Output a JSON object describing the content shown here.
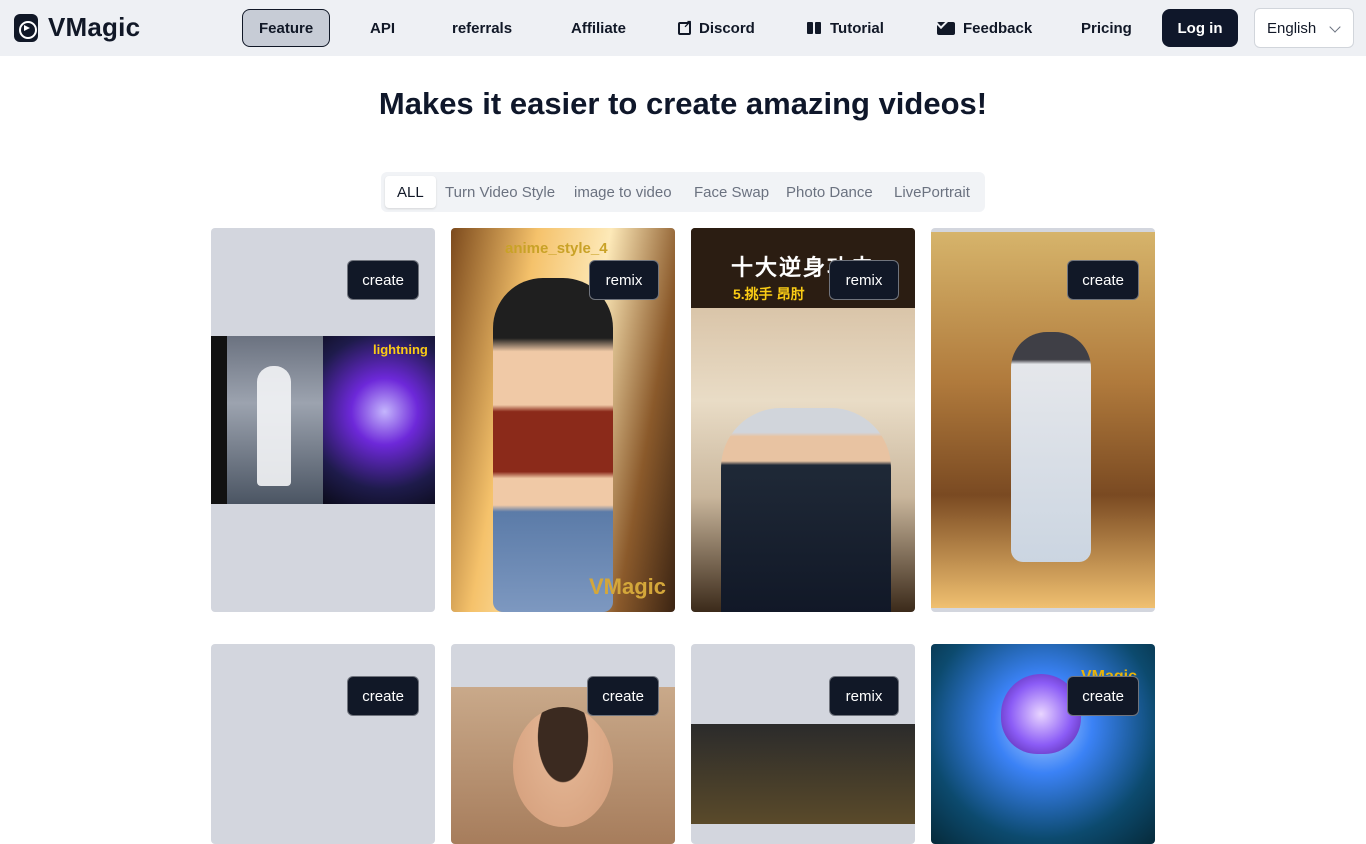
{
  "header": {
    "logo_text": "VMagic",
    "nav": [
      {
        "label": "Feature",
        "active": true
      },
      {
        "label": "API"
      },
      {
        "label": "referrals"
      },
      {
        "label": "Affiliate"
      },
      {
        "label": "Discord",
        "icon": "external-link-icon"
      },
      {
        "label": "Tutorial",
        "icon": "book-icon"
      },
      {
        "label": "Feedback",
        "icon": "mail-icon"
      },
      {
        "label": "Pricing"
      }
    ],
    "login_label": "Log in",
    "language": "English"
  },
  "main": {
    "title": "Makes it easier to create amazing videos!",
    "tabs": [
      {
        "label": "ALL",
        "active": true
      },
      {
        "label": "Turn Video Style"
      },
      {
        "label": "image to video"
      },
      {
        "label": "Face Swap"
      },
      {
        "label": "Photo Dance"
      },
      {
        "label": "LivePortrait"
      }
    ],
    "cards": [
      {
        "button": "create",
        "overlay_text": "lightning"
      },
      {
        "button": "remix",
        "overlay_text": "anime_style_4",
        "watermark": "VMagic"
      },
      {
        "button": "remix",
        "overlay_text": "十大逆身功夫",
        "overlay_subtext": "5.挑手 昂肘"
      },
      {
        "button": "create"
      },
      {
        "button": "create"
      },
      {
        "button": "create"
      },
      {
        "button": "remix"
      },
      {
        "button": "create",
        "watermark": "VMagic"
      }
    ]
  },
  "colors": {
    "header_bg": "#eef0f4",
    "button_dark": "#111827",
    "card_placeholder": "#d3d6de"
  }
}
